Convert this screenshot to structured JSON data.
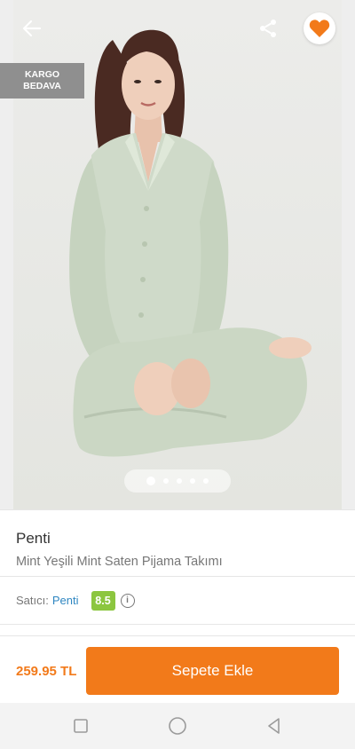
{
  "header": {
    "back_icon": "arrow-left-icon",
    "share_icon": "share-icon",
    "favorite_icon": "heart-icon"
  },
  "badge": {
    "line1": "KARGO",
    "line2": "BEDAVA"
  },
  "gallery": {
    "image_count": 5,
    "active_index": 0
  },
  "product": {
    "brand": "Penti",
    "name": "Mint Yeşili Mint Saten Pijama Takımı"
  },
  "seller": {
    "label": "Satıcı:",
    "name": "Penti",
    "score": "8.5",
    "info_icon": "info-icon"
  },
  "purchase": {
    "price": "259.95 TL",
    "add_to_cart_label": "Sepete Ekle"
  },
  "system_nav": {
    "recents_icon": "square-icon",
    "home_icon": "circle-icon",
    "back_icon": "triangle-back-icon"
  },
  "colors": {
    "accent": "#f27a1a",
    "seller_link": "#2e86c1",
    "score_badge": "#8cc63f",
    "badge_bg": "#8f8f8f"
  }
}
